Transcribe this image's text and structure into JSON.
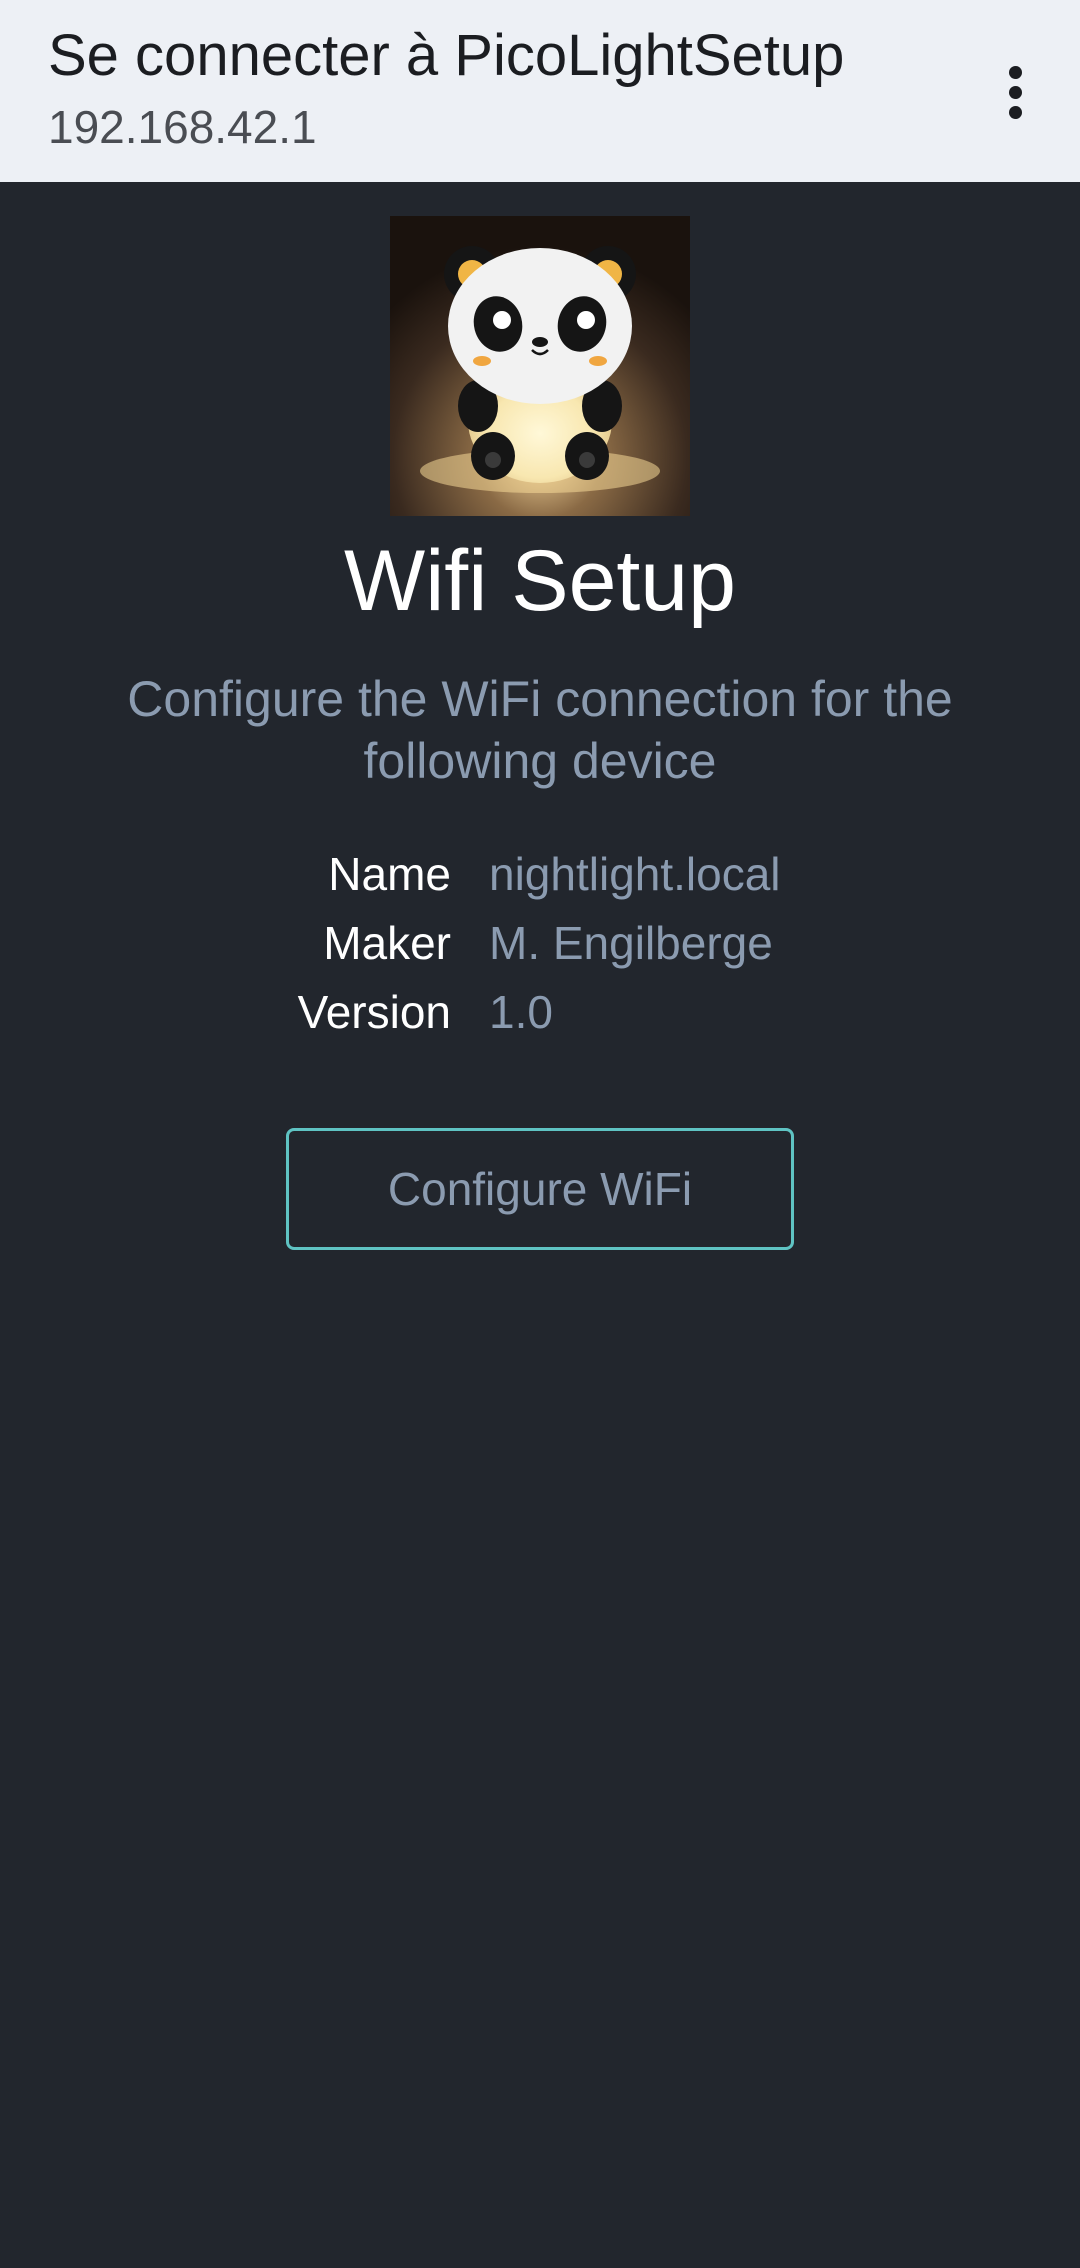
{
  "header": {
    "title": "Se connecter à PicoLightSetup",
    "url": "192.168.42.1",
    "menu_icon": "more-vert-icon"
  },
  "main": {
    "logo_icon": "panda-nightlight-icon",
    "heading": "Wifi Setup",
    "subtitle": "Configure the WiFi connection for the following device",
    "device_info": [
      {
        "key": "Name",
        "value": "nightlight.local"
      },
      {
        "key": "Maker",
        "value": "M. Engilberge"
      },
      {
        "key": "Version",
        "value": "1.0"
      }
    ],
    "configure_button": "Configure WiFi"
  },
  "colors": {
    "background": "#22262d",
    "header_background": "#edf0f5",
    "accent_border": "#5fc3c3",
    "muted_text": "#8b9bb0"
  }
}
